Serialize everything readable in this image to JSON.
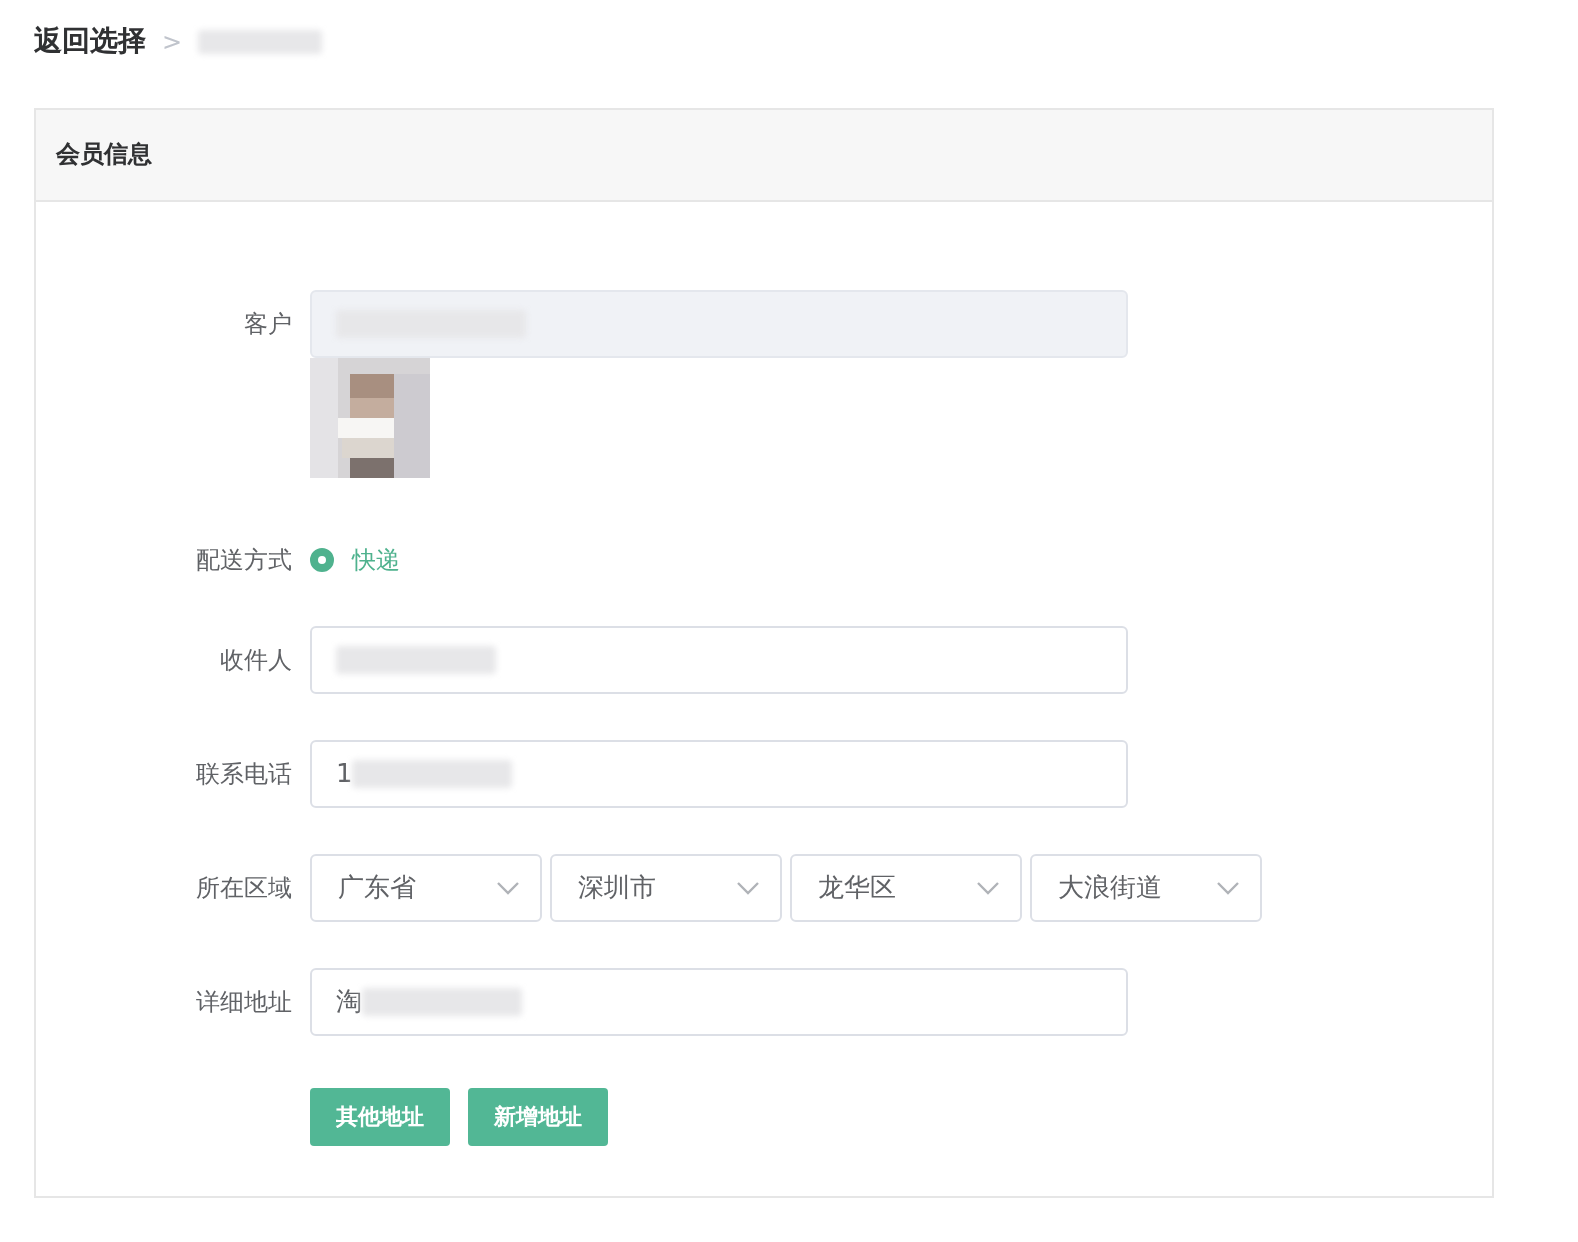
{
  "breadcrumb": {
    "back": "返回选择",
    "separator": ">"
  },
  "card": {
    "title": "会员信息"
  },
  "customer": {
    "label": "客户",
    "disabled": true
  },
  "delivery": {
    "label": "配送方式",
    "options": [
      {
        "label": "快递",
        "selected": true
      }
    ]
  },
  "fields": [
    {
      "label": "收件人"
    },
    {
      "label": "联系电话",
      "value": "1"
    },
    {
      "label": "所在区域",
      "kind": "selects",
      "selects": [
        "广东省",
        "深圳市",
        "龙华区",
        "大浪街道"
      ]
    },
    {
      "label": "详细地址",
      "value": "淘"
    }
  ],
  "buttons": [
    "其他地址",
    "新增地址"
  ]
}
